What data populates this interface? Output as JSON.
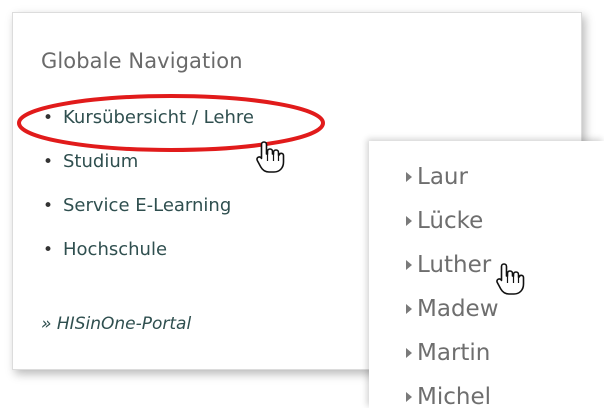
{
  "nav": {
    "title": "Globale Navigation",
    "items": [
      {
        "label": "Kursübersicht / Lehre"
      },
      {
        "label": "Studium"
      },
      {
        "label": "Service E-Learning"
      },
      {
        "label": "Hochschule"
      }
    ],
    "portal_label": "» HISinOne-Portal"
  },
  "people": {
    "items": [
      {
        "label": "Laur"
      },
      {
        "label": "Lücke"
      },
      {
        "label": "Luther"
      },
      {
        "label": "Madew"
      },
      {
        "label": "Martin"
      },
      {
        "label": "Michel"
      }
    ]
  },
  "colors": {
    "highlight": "#e11b1b",
    "link": "#2f4f4f",
    "title": "#6a6a6a"
  },
  "icons": [
    "pointing-hand-cursor-icon",
    "list-triangle-icon",
    "bullet-icon"
  ]
}
